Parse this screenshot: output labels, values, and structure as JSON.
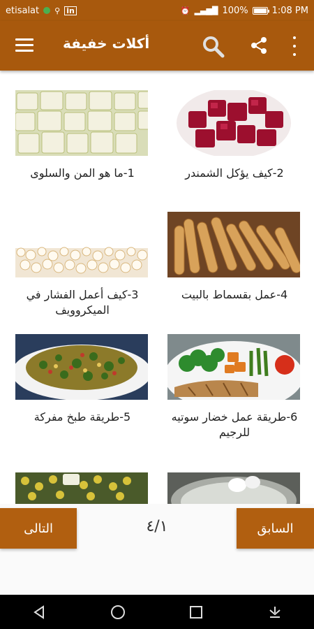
{
  "status_bar": {
    "carrier": "etisalat",
    "battery": "100%",
    "time": "1:08 PM",
    "battery_level": 1.0
  },
  "app_bar": {
    "title": "أكلات خفيفة",
    "icons": [
      "menu-icon",
      "search-icon",
      "share-icon",
      "overflow-menu-icon"
    ]
  },
  "recipes": [
    {
      "title": "1-ما هو المن والسلوى"
    },
    {
      "title": "2-كيف يؤكل الشمندر"
    },
    {
      "title": "3-كيف أعمل الفشار في الميكروويف"
    },
    {
      "title": "4-عمل بقسماط بالبيت"
    },
    {
      "title": "5-طريقة طبخ مفركة"
    },
    {
      "title": "6-طريقة عمل خضار سوتيه للرجيم"
    },
    {
      "title": ""
    },
    {
      "title": ""
    }
  ],
  "pagination": {
    "prev_label": "السابق",
    "next_label": "التالى",
    "page_indicator": "٤/١"
  },
  "colors": {
    "primary": "#a8590d",
    "button": "#b15f10"
  },
  "nav_bar": {
    "icons": [
      "back-icon",
      "home-icon",
      "recents-icon",
      "notification-icon"
    ]
  }
}
